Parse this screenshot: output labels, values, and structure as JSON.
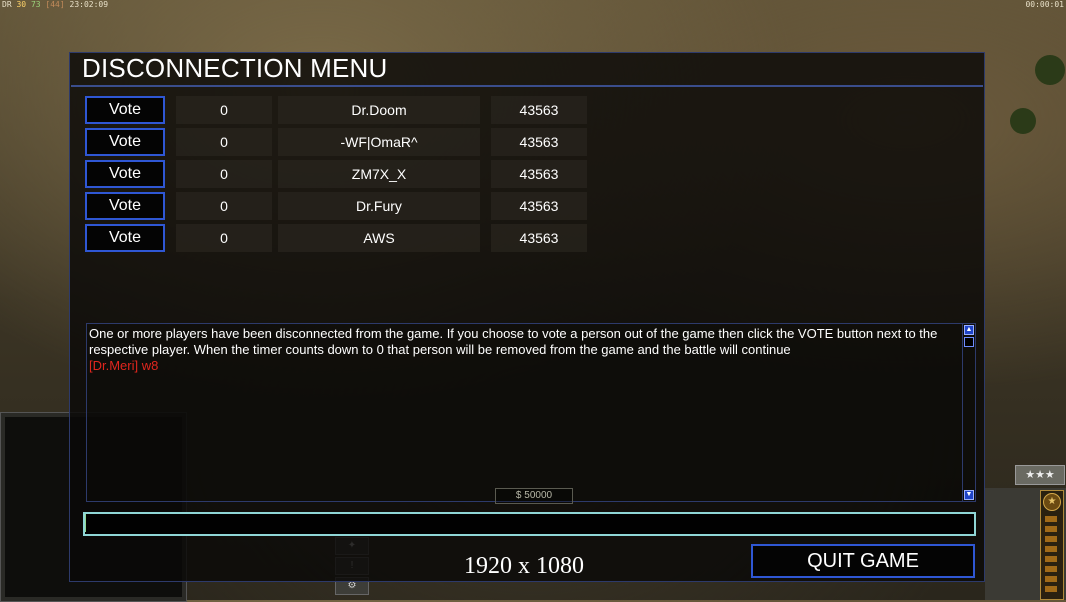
{
  "hud": {
    "top_left_prefix": "DR",
    "top_left_a": "30",
    "top_left_b": "73",
    "top_left_c": "[44]",
    "top_left_time": "23:02:09",
    "top_right_time": "00:00:01"
  },
  "background_hud": {
    "money": "$ 50000",
    "stars": "★★★",
    "rank_emblem": "★",
    "tool_glyphs": [
      "✦",
      "!",
      "⚙"
    ]
  },
  "dialog": {
    "title": "DISCONNECTION MENU",
    "vote_label": "Vote",
    "players": [
      {
        "count": "0",
        "name": "Dr.Doom",
        "ping": "43563"
      },
      {
        "count": "0",
        "name": "-WF|OmaR^",
        "ping": "43563"
      },
      {
        "count": "0",
        "name": "ZM7X_X",
        "ping": "43563"
      },
      {
        "count": "0",
        "name": "Dr.Fury",
        "ping": "43563"
      },
      {
        "count": "0",
        "name": "AWS",
        "ping": "43563"
      }
    ],
    "message": "One or more players have been disconnected from the game. If you choose to vote a person out of the game then click the VOTE button next to the respective player. When the timer counts down to 0 that person will be removed from the game and the battle will continue",
    "chat_line": "[Dr.Meri] w8",
    "chat_input_value": "",
    "quit_label": "QUIT GAME"
  },
  "overlay": {
    "resolution_label": "1920 x 1080"
  },
  "colors": {
    "button_border": "#2f57d4",
    "chat_red": "#e0261e",
    "input_border": "#8fd6d6"
  }
}
